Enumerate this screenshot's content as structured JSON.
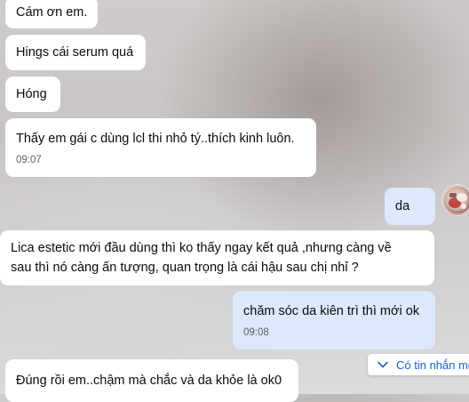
{
  "chat": {
    "messages": [
      {
        "id": "m1",
        "side": "in",
        "text": "Cám ơn em."
      },
      {
        "id": "m2",
        "side": "in",
        "text": "Hings cái serum quá"
      },
      {
        "id": "m3",
        "side": "in",
        "text": "Hóng"
      },
      {
        "id": "m4",
        "side": "in",
        "text": "Thấy em gái c dùng lcl thi nhỏ tý..thích kinh luôn.",
        "time": "09:07"
      },
      {
        "id": "m5",
        "side": "out",
        "text": "da"
      },
      {
        "id": "m6",
        "side": "in",
        "lines": [
          "Lica estetic mới đầu dùng thì ko thấy ngay kết quả ,nhưng càng về",
          "sau thì nó càng ấn tượng, quan trọng là cái hậu sau chị nhỉ  ?"
        ]
      },
      {
        "id": "m7",
        "side": "out",
        "text": "chăm sóc da kiên trì thì mới ok",
        "time": "09:08"
      },
      {
        "id": "m8",
        "side": "in",
        "text": "Đúng rồi em..chậm mà chắc và da khỏe là ok0"
      }
    ],
    "new_messages_label": "Có tin nhắn mới",
    "new_messages_icon": "chevron-down-icon",
    "avatar_icon": "avatar",
    "colors": {
      "incoming_bubble": "#ffffff",
      "outgoing_bubble": "#dbe9fb",
      "link_accent": "#1a5fd1"
    }
  }
}
